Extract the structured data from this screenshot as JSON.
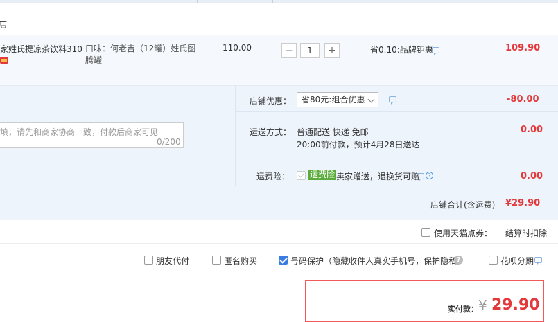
{
  "shop": {
    "name": "店"
  },
  "item": {
    "title": "家姓氏提凉茶饮料310...",
    "spec": "口味：何老吉（12罐）姓氏图腾罐",
    "unit_price": "110.00",
    "qty": "1",
    "discount": "省0.10:品牌钜惠",
    "subtotal": "109.90"
  },
  "message": {
    "placeholder": "填，请先和商家协商一致，付款后商家可见",
    "counter": "0/200"
  },
  "shop_discount": {
    "label": "店铺优惠：",
    "selected": "省80元:组合优惠",
    "amount": "-80.00"
  },
  "delivery": {
    "label": "运送方式：",
    "method": "普通配送 快递 免邮",
    "eta": "20:00前付款，预计4月28日送达",
    "amount": "0.00"
  },
  "insurance": {
    "label": "运费险：",
    "badge": "运费险",
    "text": "卖家赠送，退换货可赔",
    "amount": "0.00"
  },
  "shop_total": {
    "label": "店铺合计(含运费)",
    "amount": "¥29.90"
  },
  "points": {
    "label": "使用天猫点券：",
    "status": "结算时扣除"
  },
  "options": {
    "friend_pay": "朋友代付",
    "anonymous": "匿名购买",
    "privacy": "号码保护（隐藏收件人真实手机号，保护隐私）",
    "installment": "花呗分期"
  },
  "final": {
    "label": "实付款：",
    "currency": "¥",
    "amount": "29.90"
  },
  "colors": {
    "accent_red": "#e4393c",
    "accent_blue": "#3a7ce1",
    "badge_green": "#5aab3a"
  }
}
